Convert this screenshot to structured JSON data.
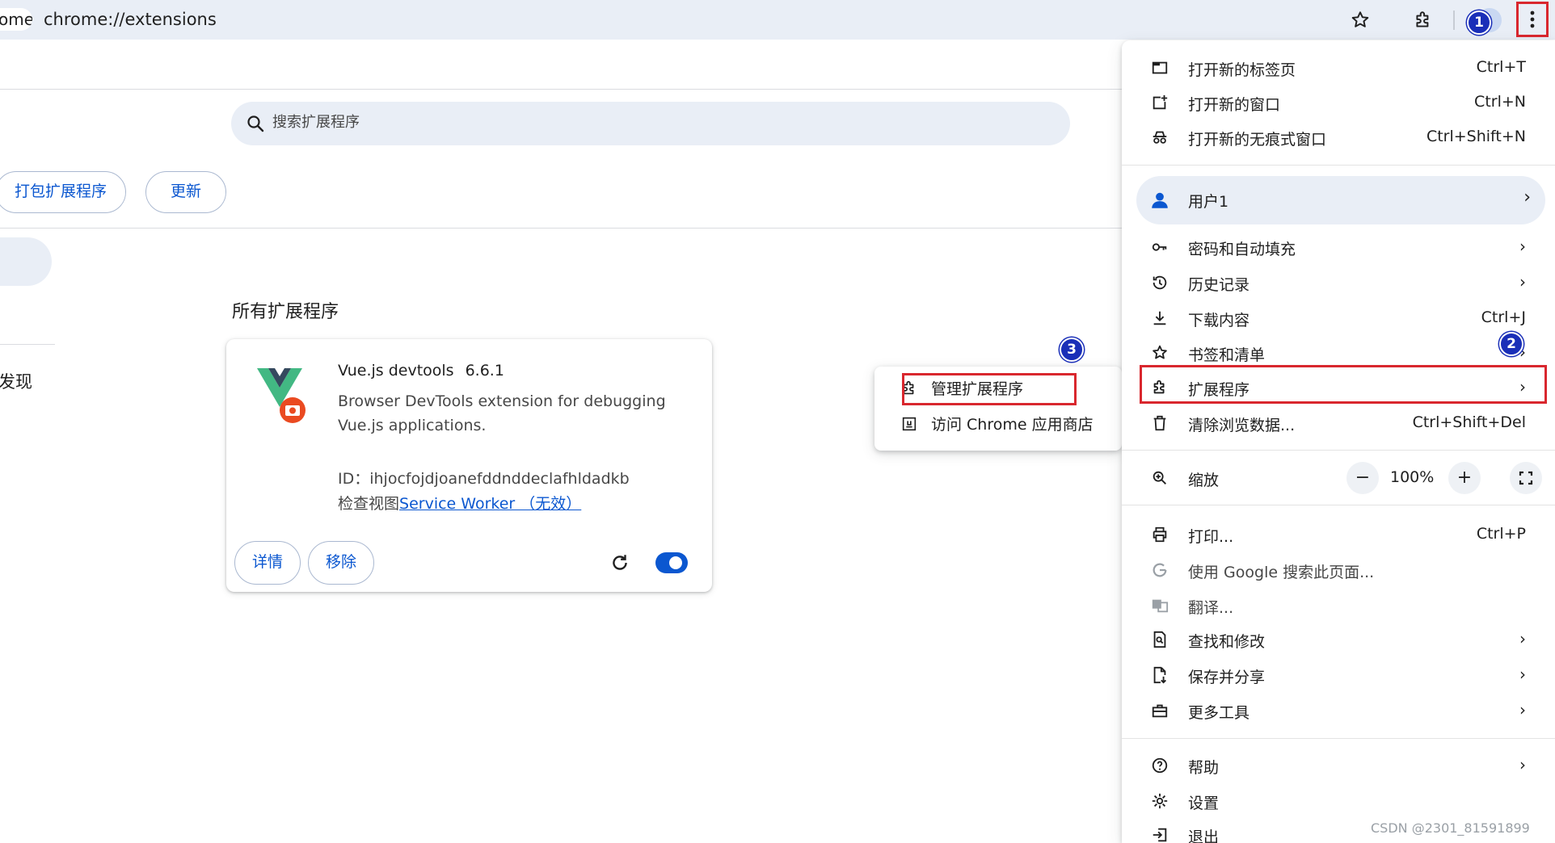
{
  "browser": {
    "url_prefix": "ome",
    "url": "chrome://extensions"
  },
  "page": {
    "search_placeholder": "搜索扩展程序",
    "buttons": {
      "pack": "打包扩展程序",
      "update": "更新"
    },
    "sidebar_text": "发现",
    "section_title": "所有扩展程序"
  },
  "extension_card": {
    "name": "Vue.js devtools",
    "version": "6.6.1",
    "description": "Browser DevTools extension for debugging Vue.js applications.",
    "id_text": "ID：ihjocfojdjoanefddnddeclafhldadkb",
    "inspect_label": "检查视图",
    "inspect_link": "Service Worker （无效）",
    "details_button": "详情",
    "remove_button": "移除",
    "enabled": true
  },
  "submenu": {
    "manage": "管理扩展程序",
    "store": "访问 Chrome 应用商店"
  },
  "menu": {
    "new_tab": {
      "label": "打开新的标签页",
      "shortcut": "Ctrl+T"
    },
    "new_window": {
      "label": "打开新的窗口",
      "shortcut": "Ctrl+N"
    },
    "incognito": {
      "label": "打开新的无痕式窗口",
      "shortcut": "Ctrl+Shift+N"
    },
    "profile": {
      "label": "用户1"
    },
    "passwords": {
      "label": "密码和自动填充"
    },
    "history": {
      "label": "历史记录"
    },
    "downloads": {
      "label": "下载内容",
      "shortcut": "Ctrl+J"
    },
    "bookmarks": {
      "label": "书签和清单"
    },
    "extensions": {
      "label": "扩展程序"
    },
    "clear_data": {
      "label": "清除浏览数据...",
      "shortcut": "Ctrl+Shift+Del"
    },
    "zoom": {
      "label": "缩放",
      "value": "100%",
      "minus": "−",
      "plus": "+"
    },
    "print": {
      "label": "打印...",
      "shortcut": "Ctrl+P"
    },
    "google_search": {
      "label": "使用 Google 搜索此页面..."
    },
    "translate": {
      "label": "翻译..."
    },
    "find": {
      "label": "查找和修改"
    },
    "save_share": {
      "label": "保存并分享"
    },
    "more_tools": {
      "label": "更多工具"
    },
    "help": {
      "label": "帮助"
    },
    "settings": {
      "label": "设置"
    },
    "exit": {
      "label": "退出"
    },
    "chevron": "›"
  },
  "badges": {
    "one": "1",
    "two": "2",
    "three": "3"
  },
  "watermark": "CSDN @2301_81591899",
  "colors": {
    "accent": "#0b57d0",
    "highlight": "#d9272e",
    "badge": "#1a2fb8",
    "omnibox": "#e9eef6"
  }
}
